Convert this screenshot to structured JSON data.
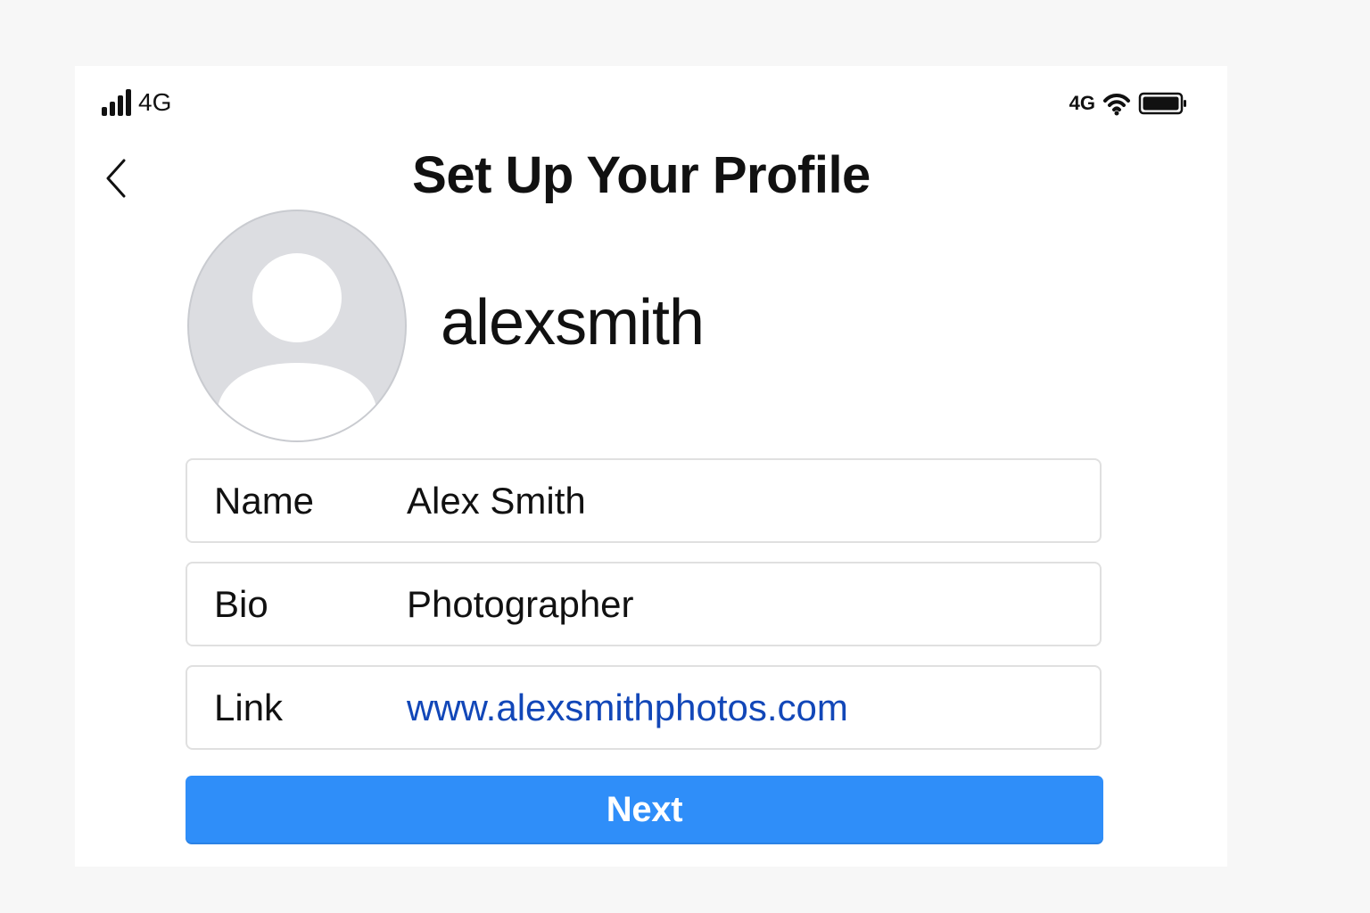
{
  "status_bar": {
    "carrier": "4G",
    "network": "4G"
  },
  "header": {
    "title": "Set Up Your Profile"
  },
  "profile": {
    "username": "alexsmith"
  },
  "fields": {
    "name": {
      "label": "Name",
      "value": "Alex Smith"
    },
    "bio": {
      "label": "Bio",
      "value": "Photographer"
    },
    "link": {
      "label": "Link",
      "value": "www.alexsmithphotos.com"
    }
  },
  "actions": {
    "next_label": "Next"
  },
  "colors": {
    "primary_button": "#2f8ef9",
    "link_text": "#1247b8",
    "avatar_fill": "#dcdde1",
    "avatar_border": "#c9cbd0",
    "field_border": "#e0e0e0"
  },
  "icons": {
    "back": "chevron-left-icon",
    "signal": "signal-bars-icon",
    "wifi": "wifi-icon",
    "battery": "battery-icon",
    "avatar": "user-placeholder-icon"
  }
}
